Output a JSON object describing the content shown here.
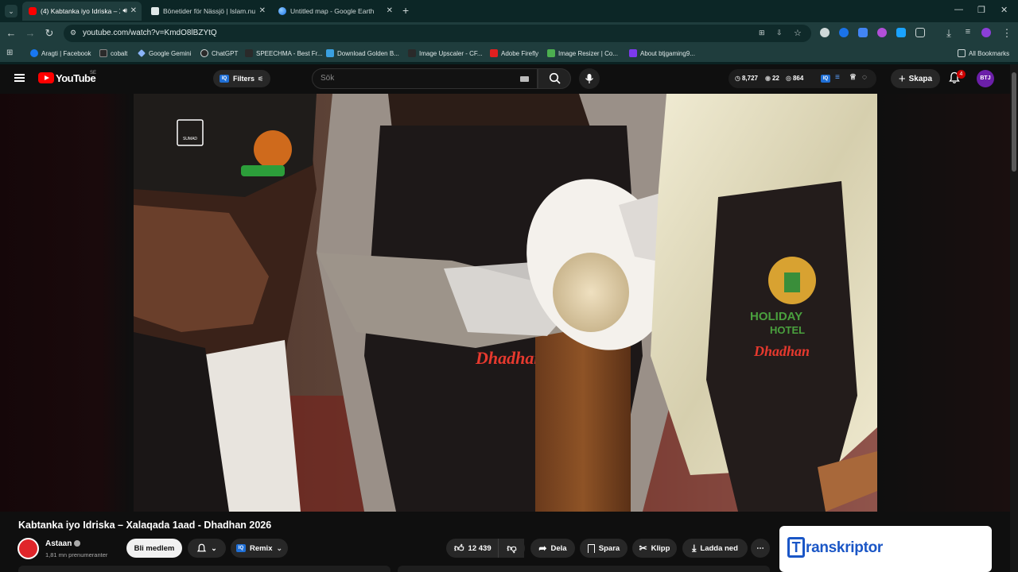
{
  "browser": {
    "tabs": [
      {
        "title": "(4) Kabtanka iyo Idriska – X",
        "active": true
      },
      {
        "title": "Bönetider för Nässjö | Islam.nu",
        "active": false
      },
      {
        "title": "Untitled map - Google Earth",
        "active": false
      }
    ],
    "url": "youtube.com/watch?v=KmdO8lBZYtQ",
    "bookmarks": [
      {
        "label": "Aragti | Facebook",
        "color": "#1877f2"
      },
      {
        "label": "cobalt",
        "color": "#2a2a2a"
      },
      {
        "label": "Google Gemini",
        "color": "#8ab4f8"
      },
      {
        "label": "ChatGPT",
        "color": "#2a2a2a"
      },
      {
        "label": "SPEECHMA - Best Fr...",
        "color": "#2a2a2a"
      },
      {
        "label": "Download Golden B...",
        "color": "#3aa0e0"
      },
      {
        "label": "Image Upscaler - CF...",
        "color": "#2a2a2a"
      },
      {
        "label": "Adobe Firefly",
        "color": "#e02020"
      },
      {
        "label": "Image Resizer | Co...",
        "color": "#4caf50"
      },
      {
        "label": "About btjgaming9...",
        "color": "#7c3aed"
      }
    ],
    "all_bookmarks": "All Bookmarks"
  },
  "youtube": {
    "logo_text": "YouTube",
    "country": "SE",
    "filters_label": "Filters",
    "iq_label": "IQ",
    "search_placeholder": "Sök",
    "stats": {
      "views": "8,727",
      "likes": "22",
      "count": "864"
    },
    "create_label": "Skapa",
    "notifications": "4",
    "avatar_initials": "BTJ",
    "accent_red": "#ff0000",
    "video": {
      "watermark": "SUMAD",
      "apron_brand": "Dhadhan",
      "apron_hotel_top": "HOLIDAY",
      "apron_hotel_bottom": "HOTEL",
      "title": "Kabtanka iyo Idriska – Xalaqada 1aad - Dhadhan 2026"
    },
    "channel": {
      "name": "Astaan",
      "subscribers": "1,81 mn prenumeranter"
    },
    "actions": {
      "member": "Bli medlem",
      "remix": "Remix",
      "likes": "12 439",
      "share": "Dela",
      "save": "Spara",
      "clip": "Klipp",
      "download": "Ladda ned"
    },
    "ad": {
      "brand_initial": "T",
      "brand_rest": "ranskriptor"
    }
  }
}
